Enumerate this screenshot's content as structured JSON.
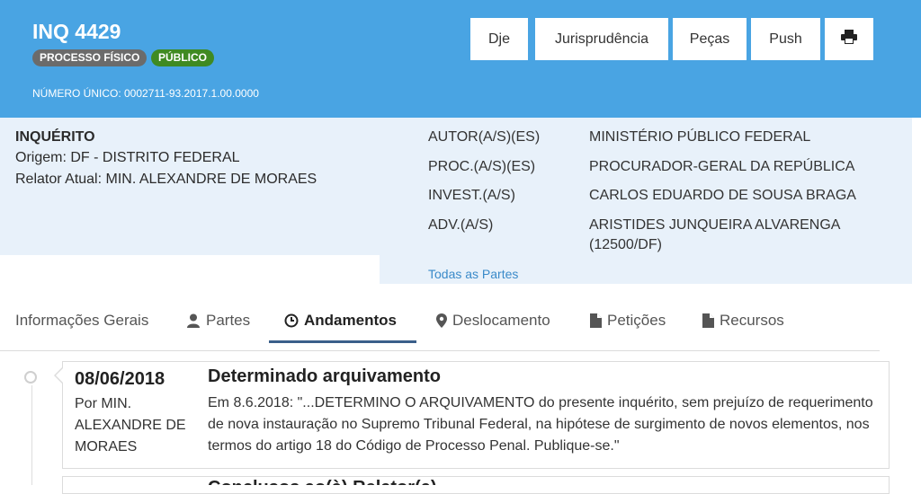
{
  "header": {
    "title": "INQ 4429",
    "badges": [
      "PROCESSO FÍSICO",
      "PÚBLICO"
    ],
    "numero_unico": "NÚMERO ÚNICO: 0002711-93.2017.1.00.0000",
    "buttons": [
      "Dje",
      "Jurisprudência",
      "Peças",
      "Push"
    ],
    "print_icon": "print-icon",
    "colors": {
      "header_bg": "#49a4e3",
      "badge_fisico": "#6b6b6b",
      "badge_publico": "#3f8a22"
    }
  },
  "info": {
    "class": "INQUÉRITO",
    "origem": "Origem: DF - DISTRITO FEDERAL",
    "relator": "Relator Atual: MIN. ALEXANDRE DE MORAES",
    "parties": [
      {
        "label": "AUTOR(A/S)(ES)",
        "value": "MINISTÉRIO PÚBLICO FEDERAL"
      },
      {
        "label": "PROC.(A/S)(ES)",
        "value": "PROCURADOR-GERAL DA REPÚBLICA"
      },
      {
        "label": "INVEST.(A/S)",
        "value": "CARLOS EDUARDO DE SOUSA BRAGA"
      },
      {
        "label": "ADV.(A/S)",
        "value": "ARISTIDES JUNQUEIRA ALVARENGA (12500/DF)"
      }
    ],
    "todas_partes": "Todas as Partes"
  },
  "tabs": [
    {
      "label": "Informações Gerais",
      "icon": ""
    },
    {
      "label": "Partes",
      "icon": "person-icon"
    },
    {
      "label": "Andamentos",
      "icon": "clock-icon",
      "active": true
    },
    {
      "label": "Deslocamento",
      "icon": "map-marker-icon"
    },
    {
      "label": "Petições",
      "icon": "file-icon"
    },
    {
      "label": "Recursos",
      "icon": "file-icon"
    }
  ],
  "andamentos": [
    {
      "date": "08/06/2018",
      "by": "Por MIN. ALEXANDRE DE MORAES",
      "title": "Determinado arquivamento",
      "text": "Em 8.6.2018: \"...DETERMINO O ARQUIVAMENTO do presente inquérito, sem prejuízo de requerimento de nova instauração no Supremo Tribunal Federal, na hipótese de surgimento de novos elementos, nos termos do artigo 18 do Código de Processo Penal. Publique-se.\""
    },
    {
      "title": "Conclusos ao(à) Relator(a)"
    }
  ]
}
